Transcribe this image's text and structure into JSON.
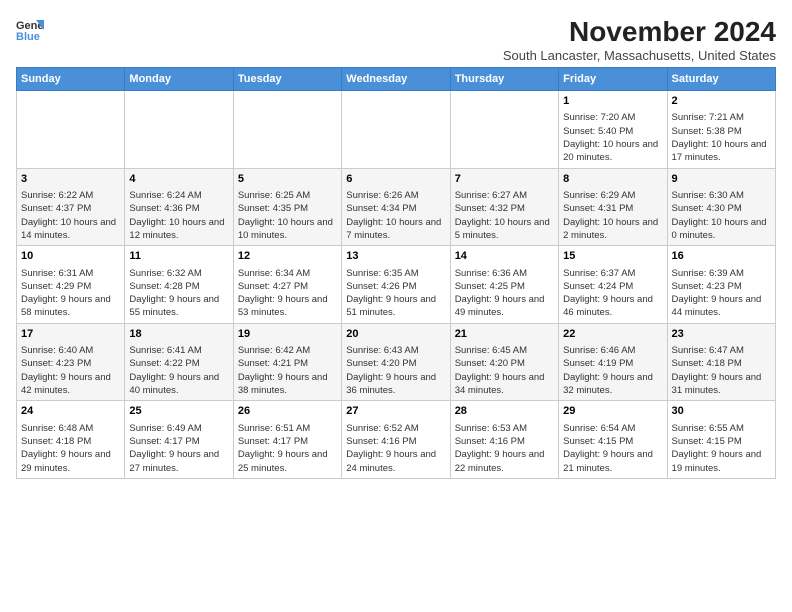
{
  "logo": {
    "line1": "General",
    "line2": "Blue"
  },
  "title": "November 2024",
  "subtitle": "South Lancaster, Massachusetts, United States",
  "days_header": [
    "Sunday",
    "Monday",
    "Tuesday",
    "Wednesday",
    "Thursday",
    "Friday",
    "Saturday"
  ],
  "weeks": [
    [
      {
        "day": "",
        "info": ""
      },
      {
        "day": "",
        "info": ""
      },
      {
        "day": "",
        "info": ""
      },
      {
        "day": "",
        "info": ""
      },
      {
        "day": "",
        "info": ""
      },
      {
        "day": "1",
        "info": "Sunrise: 7:20 AM\nSunset: 5:40 PM\nDaylight: 10 hours and 20 minutes."
      },
      {
        "day": "2",
        "info": "Sunrise: 7:21 AM\nSunset: 5:38 PM\nDaylight: 10 hours and 17 minutes."
      }
    ],
    [
      {
        "day": "3",
        "info": "Sunrise: 6:22 AM\nSunset: 4:37 PM\nDaylight: 10 hours and 14 minutes."
      },
      {
        "day": "4",
        "info": "Sunrise: 6:24 AM\nSunset: 4:36 PM\nDaylight: 10 hours and 12 minutes."
      },
      {
        "day": "5",
        "info": "Sunrise: 6:25 AM\nSunset: 4:35 PM\nDaylight: 10 hours and 10 minutes."
      },
      {
        "day": "6",
        "info": "Sunrise: 6:26 AM\nSunset: 4:34 PM\nDaylight: 10 hours and 7 minutes."
      },
      {
        "day": "7",
        "info": "Sunrise: 6:27 AM\nSunset: 4:32 PM\nDaylight: 10 hours and 5 minutes."
      },
      {
        "day": "8",
        "info": "Sunrise: 6:29 AM\nSunset: 4:31 PM\nDaylight: 10 hours and 2 minutes."
      },
      {
        "day": "9",
        "info": "Sunrise: 6:30 AM\nSunset: 4:30 PM\nDaylight: 10 hours and 0 minutes."
      }
    ],
    [
      {
        "day": "10",
        "info": "Sunrise: 6:31 AM\nSunset: 4:29 PM\nDaylight: 9 hours and 58 minutes."
      },
      {
        "day": "11",
        "info": "Sunrise: 6:32 AM\nSunset: 4:28 PM\nDaylight: 9 hours and 55 minutes."
      },
      {
        "day": "12",
        "info": "Sunrise: 6:34 AM\nSunset: 4:27 PM\nDaylight: 9 hours and 53 minutes."
      },
      {
        "day": "13",
        "info": "Sunrise: 6:35 AM\nSunset: 4:26 PM\nDaylight: 9 hours and 51 minutes."
      },
      {
        "day": "14",
        "info": "Sunrise: 6:36 AM\nSunset: 4:25 PM\nDaylight: 9 hours and 49 minutes."
      },
      {
        "day": "15",
        "info": "Sunrise: 6:37 AM\nSunset: 4:24 PM\nDaylight: 9 hours and 46 minutes."
      },
      {
        "day": "16",
        "info": "Sunrise: 6:39 AM\nSunset: 4:23 PM\nDaylight: 9 hours and 44 minutes."
      }
    ],
    [
      {
        "day": "17",
        "info": "Sunrise: 6:40 AM\nSunset: 4:23 PM\nDaylight: 9 hours and 42 minutes."
      },
      {
        "day": "18",
        "info": "Sunrise: 6:41 AM\nSunset: 4:22 PM\nDaylight: 9 hours and 40 minutes."
      },
      {
        "day": "19",
        "info": "Sunrise: 6:42 AM\nSunset: 4:21 PM\nDaylight: 9 hours and 38 minutes."
      },
      {
        "day": "20",
        "info": "Sunrise: 6:43 AM\nSunset: 4:20 PM\nDaylight: 9 hours and 36 minutes."
      },
      {
        "day": "21",
        "info": "Sunrise: 6:45 AM\nSunset: 4:20 PM\nDaylight: 9 hours and 34 minutes."
      },
      {
        "day": "22",
        "info": "Sunrise: 6:46 AM\nSunset: 4:19 PM\nDaylight: 9 hours and 32 minutes."
      },
      {
        "day": "23",
        "info": "Sunrise: 6:47 AM\nSunset: 4:18 PM\nDaylight: 9 hours and 31 minutes."
      }
    ],
    [
      {
        "day": "24",
        "info": "Sunrise: 6:48 AM\nSunset: 4:18 PM\nDaylight: 9 hours and 29 minutes."
      },
      {
        "day": "25",
        "info": "Sunrise: 6:49 AM\nSunset: 4:17 PM\nDaylight: 9 hours and 27 minutes."
      },
      {
        "day": "26",
        "info": "Sunrise: 6:51 AM\nSunset: 4:17 PM\nDaylight: 9 hours and 25 minutes."
      },
      {
        "day": "27",
        "info": "Sunrise: 6:52 AM\nSunset: 4:16 PM\nDaylight: 9 hours and 24 minutes."
      },
      {
        "day": "28",
        "info": "Sunrise: 6:53 AM\nSunset: 4:16 PM\nDaylight: 9 hours and 22 minutes."
      },
      {
        "day": "29",
        "info": "Sunrise: 6:54 AM\nSunset: 4:15 PM\nDaylight: 9 hours and 21 minutes."
      },
      {
        "day": "30",
        "info": "Sunrise: 6:55 AM\nSunset: 4:15 PM\nDaylight: 9 hours and 19 minutes."
      }
    ]
  ]
}
